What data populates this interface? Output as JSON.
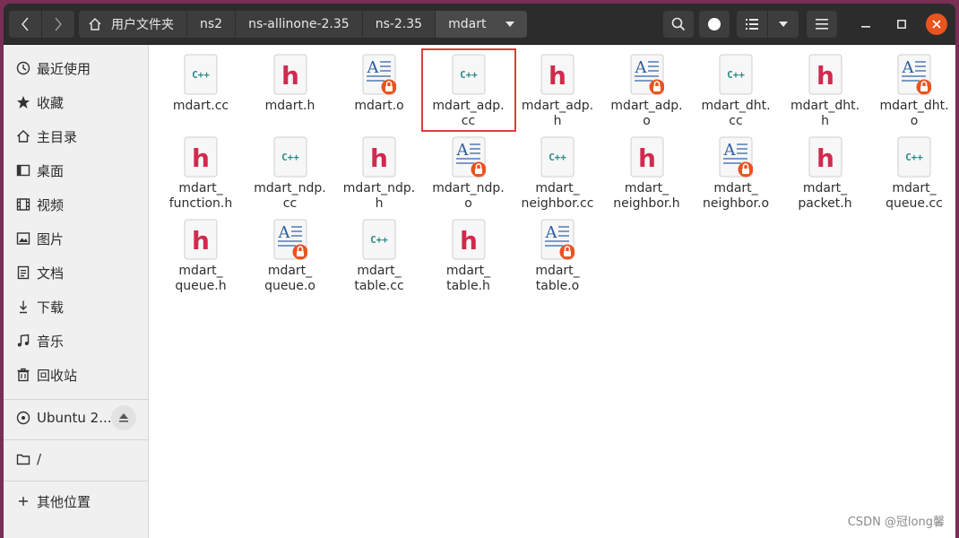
{
  "window": {
    "breadcrumbs": [
      "用户文件夹",
      "ns2",
      "ns-allinone-2.35",
      "ns-2.35",
      "mdart"
    ],
    "accent_color": "#e95420"
  },
  "sidebar": {
    "items": [
      {
        "label": "最近使用",
        "icon": "clock-icon"
      },
      {
        "label": "收藏",
        "icon": "star-icon"
      },
      {
        "label": "主目录",
        "icon": "home-icon"
      },
      {
        "label": "桌面",
        "icon": "desktop-icon"
      },
      {
        "label": "视频",
        "icon": "film-icon"
      },
      {
        "label": "图片",
        "icon": "image-icon"
      },
      {
        "label": "文档",
        "icon": "document-icon"
      },
      {
        "label": "下载",
        "icon": "download-icon"
      },
      {
        "label": "音乐",
        "icon": "music-icon"
      },
      {
        "label": "回收站",
        "icon": "trash-icon"
      }
    ],
    "device": {
      "label": "Ubuntu 2...",
      "icon": "disc-icon"
    },
    "root": {
      "label": "/",
      "icon": "folder-icon"
    },
    "other": {
      "label": "其他位置",
      "icon": "plus-icon"
    }
  },
  "files": [
    {
      "name": "mdart.cc",
      "type": "cpp"
    },
    {
      "name": "mdart.h",
      "type": "header"
    },
    {
      "name": "mdart.o",
      "type": "object"
    },
    {
      "name": "mdart_adp.cc",
      "type": "cpp",
      "selected": true
    },
    {
      "name": "mdart_adp.h",
      "type": "header"
    },
    {
      "name": "mdart_adp.o",
      "type": "object"
    },
    {
      "name": "mdart_dht.cc",
      "type": "cpp"
    },
    {
      "name": "mdart_dht.h",
      "type": "header"
    },
    {
      "name": "mdart_dht.o",
      "type": "object"
    },
    {
      "name": "mdart_function.h",
      "type": "header"
    },
    {
      "name": "mdart_ndp.cc",
      "type": "cpp"
    },
    {
      "name": "mdart_ndp.h",
      "type": "header"
    },
    {
      "name": "mdart_ndp.o",
      "type": "object"
    },
    {
      "name": "mdart_neighbor.cc",
      "type": "cpp"
    },
    {
      "name": "mdart_neighbor.h",
      "type": "header"
    },
    {
      "name": "mdart_neighbor.o",
      "type": "object"
    },
    {
      "name": "mdart_packet.h",
      "type": "header"
    },
    {
      "name": "mdart_queue.cc",
      "type": "cpp"
    },
    {
      "name": "mdart_queue.h",
      "type": "header"
    },
    {
      "name": "mdart_queue.o",
      "type": "object"
    },
    {
      "name": "mdart_table.cc",
      "type": "cpp"
    },
    {
      "name": "mdart_table.h",
      "type": "header"
    },
    {
      "name": "mdart_table.o",
      "type": "object"
    }
  ],
  "file_lines": [
    [
      "mdart.cc"
    ],
    [
      "mdart.h"
    ],
    [
      "mdart.o"
    ],
    [
      "mdart_adp.",
      "cc"
    ],
    [
      "mdart_adp.",
      "h"
    ],
    [
      "mdart_adp.",
      "o"
    ],
    [
      "mdart_dht.",
      "cc"
    ],
    [
      "mdart_dht.",
      "h"
    ],
    [
      "mdart_dht.",
      "o"
    ],
    [
      "mdart_",
      "function.h"
    ],
    [
      "mdart_ndp.",
      "cc"
    ],
    [
      "mdart_ndp.",
      "h"
    ],
    [
      "mdart_ndp.",
      "o"
    ],
    [
      "mdart_",
      "neighbor.cc"
    ],
    [
      "mdart_",
      "neighbor.h"
    ],
    [
      "mdart_",
      "neighbor.o"
    ],
    [
      "mdart_",
      "packet.h"
    ],
    [
      "mdart_",
      "queue.cc"
    ],
    [
      "mdart_",
      "queue.h"
    ],
    [
      "mdart_",
      "queue.o"
    ],
    [
      "mdart_",
      "table.cc"
    ],
    [
      "mdart_",
      "table.h"
    ],
    [
      "mdart_",
      "table.o"
    ]
  ],
  "icon_labels": {
    "cpp": "C++",
    "header": "h",
    "object": "A"
  },
  "watermark": "CSDN @冠long馨"
}
